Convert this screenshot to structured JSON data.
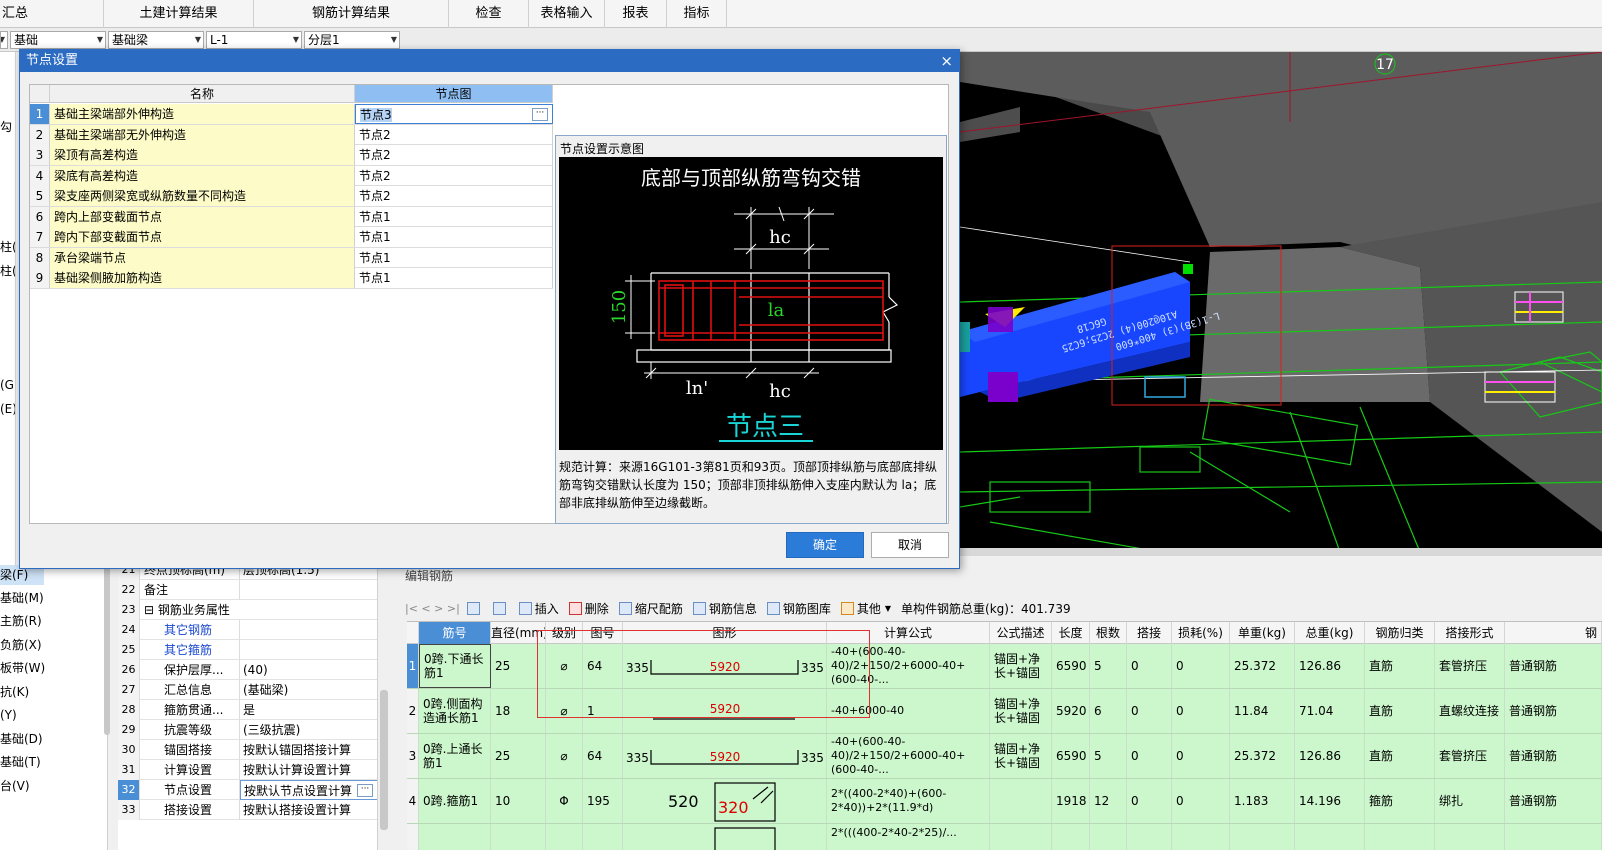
{
  "menu": [
    "汇总",
    "土建计算结果",
    "钢筋计算结果",
    "检查",
    "表格输入",
    "报表",
    "指标"
  ],
  "filters": [
    "基础",
    "基础梁",
    "L-1",
    "分层1"
  ],
  "left_stub_labels": [
    "勾",
    "柱(Z",
    "柱(Z",
    "(G)",
    "(E)"
  ],
  "left_tree": [
    "梁(F)",
    "基础(M)",
    "主筋(R)",
    "负筋(X)",
    "板带(W)",
    "抗(K)",
    "(Y)",
    "基础(D)",
    "基础(T)",
    "台(V)"
  ],
  "properties": [
    {
      "n": "21",
      "k": "终点顶标高(m)",
      "v": "层顶标高(1.5)"
    },
    {
      "n": "22",
      "k": "备注",
      "v": ""
    },
    {
      "n": "23",
      "k": "⊟ 钢筋业务属性",
      "v": ""
    },
    {
      "n": "24",
      "k": "其它钢筋",
      "v": ""
    },
    {
      "n": "25",
      "k": "其它箍筋",
      "v": ""
    },
    {
      "n": "26",
      "k": "保护层厚...",
      "v": "(40)"
    },
    {
      "n": "27",
      "k": "汇总信息",
      "v": "(基础梁)"
    },
    {
      "n": "28",
      "k": "箍筋贯通...",
      "v": "是"
    },
    {
      "n": "29",
      "k": "抗震等级",
      "v": "(三级抗震)"
    },
    {
      "n": "30",
      "k": "锚固搭接",
      "v": "按默认锚固搭接计算"
    },
    {
      "n": "31",
      "k": "计算设置",
      "v": "按默认计算设置计算"
    },
    {
      "n": "32",
      "k": "节点设置",
      "v": "按默认节点设置计算"
    },
    {
      "n": "33",
      "k": "搭接设置",
      "v": "按默认搭接设置计算"
    }
  ],
  "viewport": {
    "label_17": "17",
    "beam_text_1": "L-1(3B)(3) 400*600",
    "beam_text_2": "A10@200(4) 2C25;6C25",
    "beam_text_3": "G6C18"
  },
  "dialog": {
    "title": "节点设置",
    "close": "×",
    "col_name": "名称",
    "col_node": "节点图",
    "rows": [
      {
        "n": "1",
        "name": "基础主梁端部外伸构造",
        "node": "节点3"
      },
      {
        "n": "2",
        "name": "基础主梁端部无外伸构造",
        "node": "节点2"
      },
      {
        "n": "3",
        "name": "梁顶有高差构造",
        "node": "节点2"
      },
      {
        "n": "4",
        "name": "梁底有高差构造",
        "node": "节点2"
      },
      {
        "n": "5",
        "name": "梁支座两侧梁宽或纵筋数量不同构造",
        "node": "节点2"
      },
      {
        "n": "6",
        "name": "跨内上部变截面节点",
        "node": "节点1"
      },
      {
        "n": "7",
        "name": "跨内下部变截面节点",
        "node": "节点1"
      },
      {
        "n": "8",
        "name": "承台梁端节点",
        "node": "节点1"
      },
      {
        "n": "9",
        "name": "基础梁侧腋加筋构造",
        "node": "节点1"
      }
    ],
    "diagram_title": "节点设置示意图",
    "diagram": {
      "heading": "底部与顶部纵筋弯钩交错",
      "dim_hc": "hc",
      "dim_la": "la",
      "dim_150": "150",
      "dim_ln": "ln'",
      "node_label": "节点三"
    },
    "description": "规范计算：来源16G101-3第81页和93页。顶部顶排纵筋与底部底排纵筋弯钩交错默认长度为 150；顶部非顶排纵筋伸入支座内默认为 la；底部非底排纵筋伸至边缘截断。",
    "ok": "确定",
    "cancel": "取消"
  },
  "rebar": {
    "panel_title": "编辑钢筋",
    "toolbar": {
      "nav": "|<  <  >  >|",
      "insert": "插入",
      "delete": "删除",
      "scale": "缩尺配筋",
      "info": "钢筋信息",
      "library": "钢筋图库",
      "other": "其他",
      "total": "单构件钢筋总重(kg)：401.739"
    },
    "headers": [
      "筋号",
      "直径(mm)",
      "级别",
      "图号",
      "图形",
      "计算公式",
      "公式描述",
      "长度",
      "根数",
      "搭接",
      "损耗(%)",
      "单重(kg)",
      "总重(kg)",
      "钢筋归类",
      "搭接形式",
      "钢"
    ],
    "rows": [
      {
        "n": "1",
        "name": "0跨.下通长筋1",
        "dia": "25",
        "grade": "⌀",
        "fig": "64",
        "left": "335",
        "mid": "5920",
        "right": "335",
        "formula": "-40+(600-40-40)/2+150/2+6000-40+(600-40-...",
        "desc": "锚固+净长+锚固",
        "len": "6590",
        "count": "5",
        "lap": "0",
        "loss": "0",
        "unit": "25.372",
        "total": "126.86",
        "cat": "直筋",
        "lapform": "套管挤压",
        "type": "普通钢筋"
      },
      {
        "n": "2",
        "name": "0跨.侧面构造通长筋1",
        "dia": "18",
        "grade": "⌀",
        "fig": "1",
        "left": "",
        "mid": "5920",
        "right": "",
        "formula": "-40+6000-40",
        "desc": "锚固+净长+锚固",
        "len": "5920",
        "count": "6",
        "lap": "0",
        "loss": "0",
        "unit": "11.84",
        "total": "71.04",
        "cat": "直筋",
        "lapform": "直螺纹连接",
        "type": "普通钢筋"
      },
      {
        "n": "3",
        "name": "0跨.上通长筋1",
        "dia": "25",
        "grade": "⌀",
        "fig": "64",
        "left": "335",
        "mid": "5920",
        "right": "335",
        "formula": "-40+(600-40-40)/2+150/2+6000-40+(600-40-...",
        "desc": "锚固+净长+锚固",
        "len": "6590",
        "count": "5",
        "lap": "0",
        "loss": "0",
        "unit": "25.372",
        "total": "126.86",
        "cat": "直筋",
        "lapform": "套管挤压",
        "type": "普通钢筋"
      },
      {
        "n": "4",
        "name": "0跨.箍筋1",
        "dia": "10",
        "grade": "Φ",
        "fig": "195",
        "left": "520",
        "mid": "320",
        "right": "",
        "formula": "2*((400-2*40)+(600-2*40))+2*(11.9*d)",
        "desc": "",
        "len": "1918",
        "count": "12",
        "lap": "0",
        "loss": "0",
        "unit": "1.183",
        "total": "14.196",
        "cat": "箍筋",
        "lapform": "绑扎",
        "type": "普通钢筋"
      }
    ],
    "row5_formula": "2*(((400-2*40-2*25)/..."
  },
  "colors": {
    "accent": "#2b6bc2",
    "row_green": "#ccf7cc",
    "name_yellow": "#fdfcc8",
    "beam_blue": "#1846ff"
  }
}
